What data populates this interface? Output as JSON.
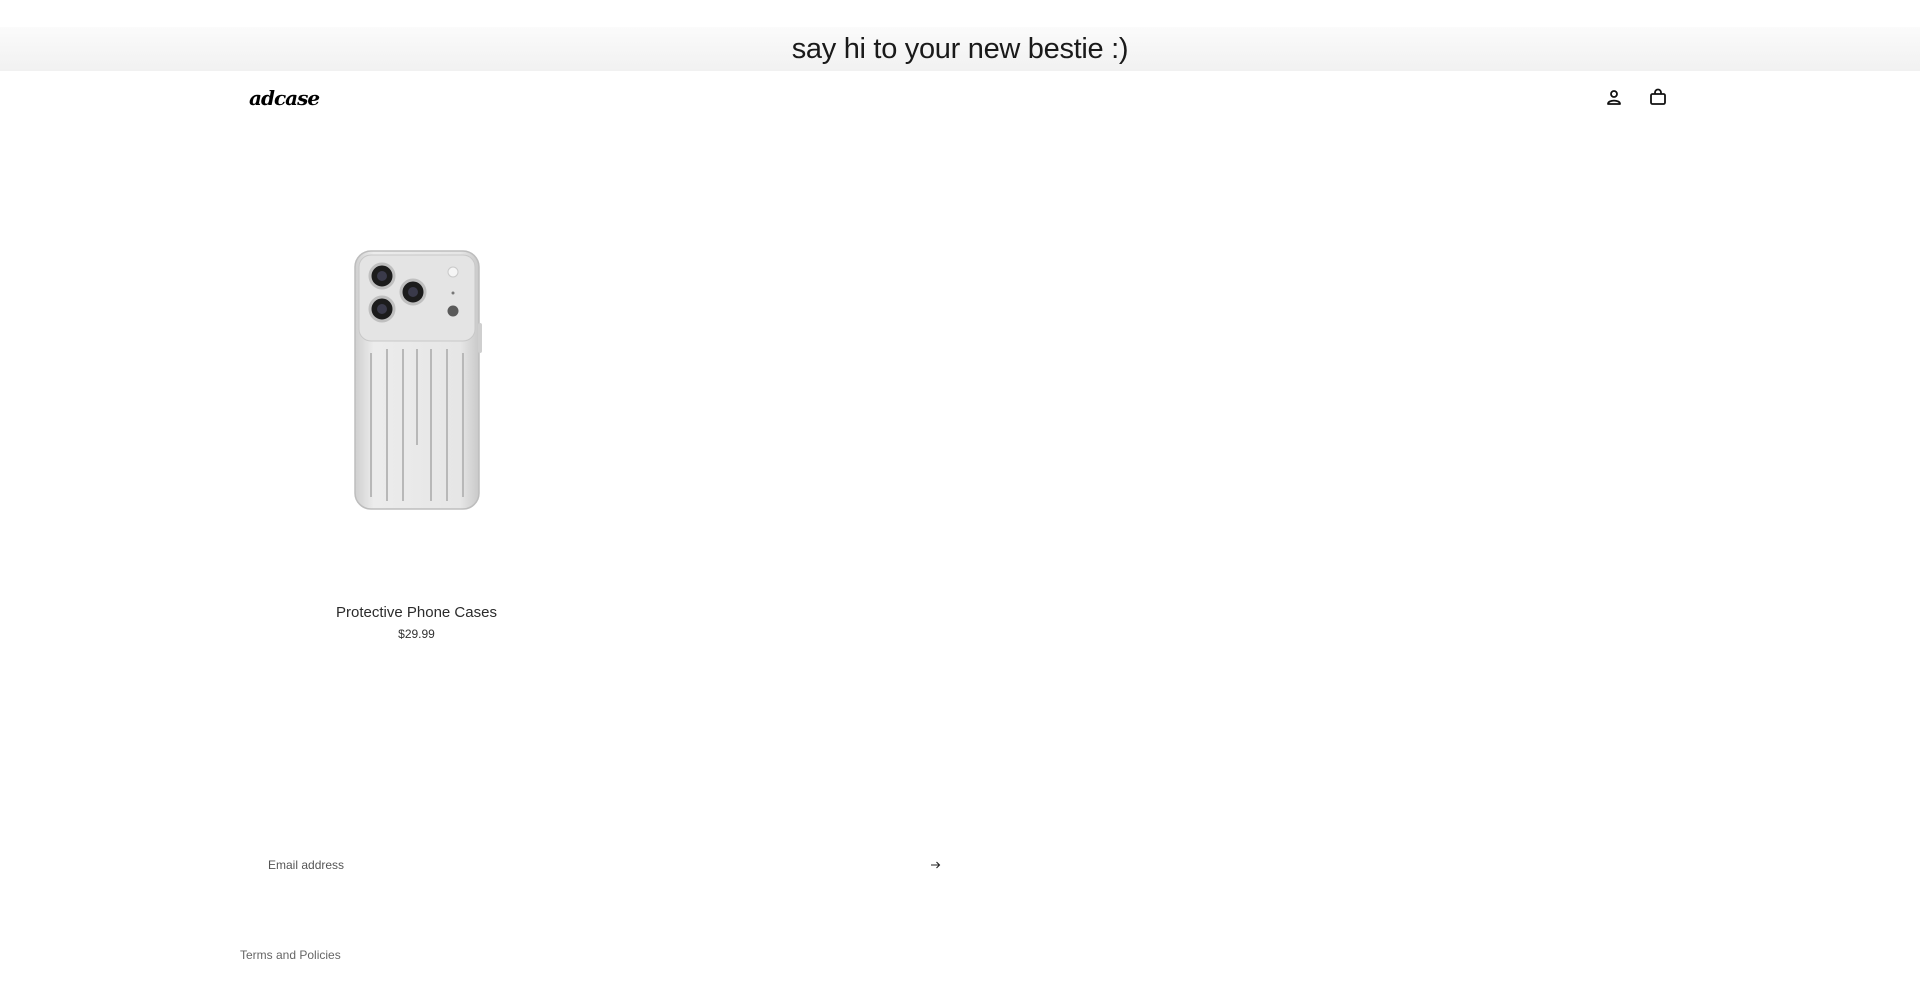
{
  "announcement": {
    "text": "say hi to your new bestie :)"
  },
  "header": {
    "logo_text": "adcase",
    "icons": {
      "account": "account-icon",
      "cart": "cart-icon"
    }
  },
  "products": [
    {
      "title": "Protective Phone Cases",
      "price": "$29.99",
      "image_icon": "phone-case-image"
    }
  ],
  "newsletter": {
    "placeholder": "Email address",
    "submit_icon": "arrow-right-icon"
  },
  "footer": {
    "terms_label": "Terms and Policies"
  },
  "colors": {
    "text": "#1a1a1a",
    "banner_bg": "#f3f3f3",
    "page_bg": "#ffffff",
    "muted": "#666666"
  }
}
